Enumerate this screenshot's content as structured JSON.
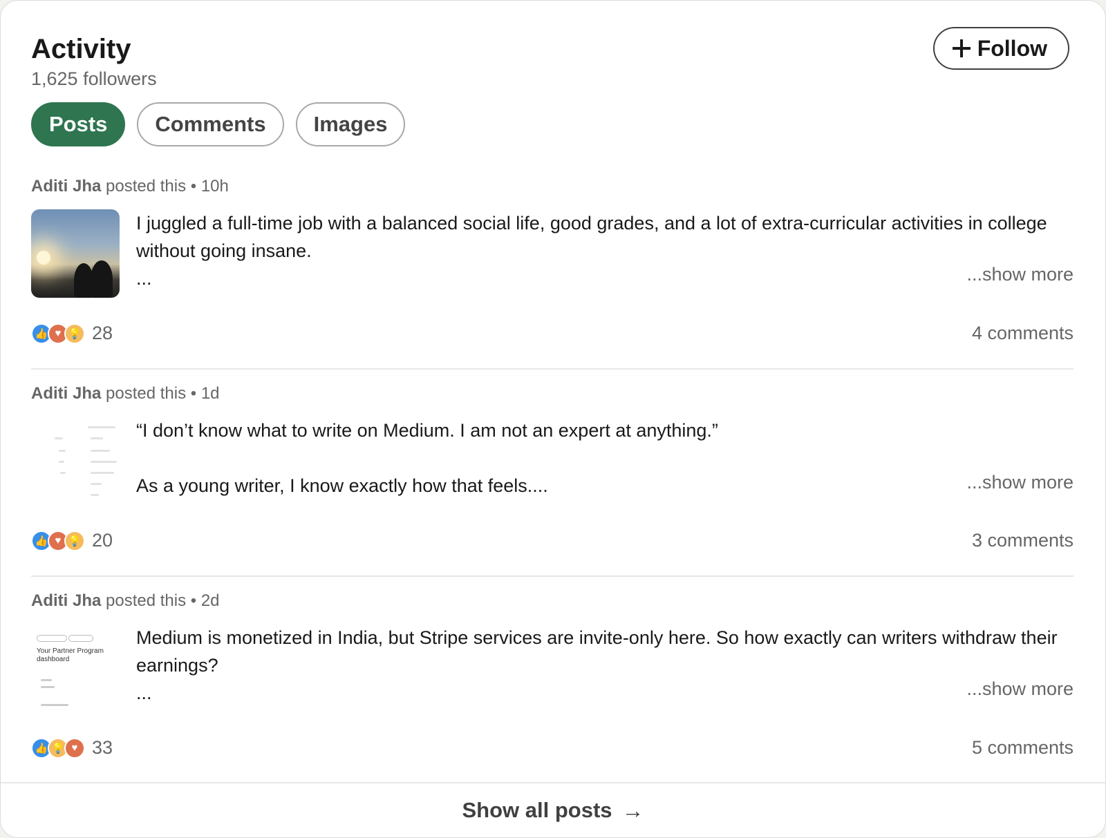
{
  "header": {
    "title": "Activity",
    "followers": "1,625 followers",
    "follow_label": "Follow"
  },
  "tabs": [
    {
      "label": "Posts",
      "active": true
    },
    {
      "label": "Comments",
      "active": false
    },
    {
      "label": "Images",
      "active": false
    }
  ],
  "posts": [
    {
      "author": "Aditi Jha",
      "action": "posted this",
      "time": "• 10h",
      "text": "I juggled a full-time job with a balanced social life, good grades, and a lot of extra-curricular activities in college without going insane.",
      "ellipsis": "...",
      "show_more": "...show more",
      "reactions": [
        "like-icon",
        "love-icon",
        "idea-icon"
      ],
      "reaction_count": "28",
      "comments": "4 comments"
    },
    {
      "author": "Aditi Jha",
      "action": "posted this",
      "time": "• 1d",
      "text_line1": "“I don’t know what to write on Medium. I am not an expert at anything.”",
      "text_line2": "As a young writer, I know exactly how that feels....",
      "show_more": "...show more",
      "reactions": [
        "like-icon",
        "love-icon",
        "idea-icon"
      ],
      "reaction_count": "20",
      "comments": "3 comments"
    },
    {
      "author": "Aditi Jha",
      "action": "posted this",
      "time": "• 2d",
      "text": "Medium is monetized in India, but Stripe services are invite-only here. So how exactly can writers withdraw their earnings?",
      "ellipsis": "...",
      "show_more": "...show more",
      "thumb_title": "Your Partner Program dashboard",
      "reactions": [
        "like-icon",
        "idea-icon",
        "love-icon"
      ],
      "reaction_count": "33",
      "comments": "5 comments"
    }
  ],
  "footer": {
    "show_all": "Show all posts",
    "arrow": "→"
  },
  "colors": {
    "accent_green": "#2e7550",
    "like_blue": "#378fe9",
    "love_orange": "#df704d",
    "idea_yellow": "#f5bb5c"
  }
}
